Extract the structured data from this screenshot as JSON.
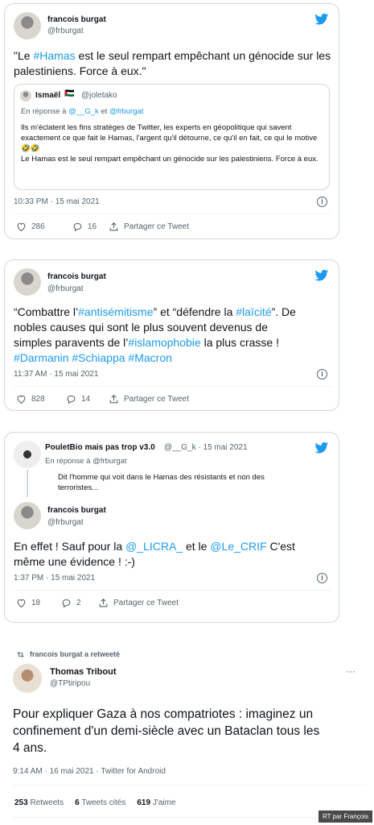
{
  "tweet1": {
    "name": "francois burgat",
    "handle": "@frburgat",
    "text_parts": [
      "\"Le ",
      "#Hamas",
      " est le seul rempart empêchant un génocide sur les palestiniens. Force à eux.\""
    ],
    "quote": {
      "name": "Ismaël",
      "flag": "🇵🇸",
      "handle": "@joletako",
      "reply_prefix": "En réponse à",
      "reply_users": [
        "@__G_k",
        "et",
        "@frburgat"
      ],
      "text": "Ils m'éclatent les fins stratèges de Twitter, les experts en géopolitique qui savent exactement ce que fait le Hamas, l'argent qu'il détourne, ce qu'il en fait, ce qui le motive🤣🤣\nLe Hamas est le seul rempart empêchant un génocide sur les palestiniens. Force à eux."
    },
    "time": "10:33 PM · 15 mai 2021",
    "likes": "286",
    "replies": "16",
    "share_label": "Partager ce Tweet"
  },
  "tweet2": {
    "name": "francois burgat",
    "handle": "@frburgat",
    "line1_parts": [
      "“Combattre l’",
      "#antisémitisme",
      "” et “défendre la ",
      "#laïcité",
      "”. De"
    ],
    "line2": "nobles causes qui  sont le plus souvent devenus de",
    "line3_parts": [
      "simples paravents de l’",
      "#islamophobie",
      " la plus crasse !"
    ],
    "line4": "#Darmanin #Schiappa #Macron",
    "time": "11:37 AM · 15 mai 2021",
    "likes": "828",
    "replies": "14",
    "share_label": "Partager ce Tweet"
  },
  "tweet3": {
    "parent_name": "PouletBio mais pas trop v3.0",
    "parent_handle_time": "@__G_k · 15 mai 2021",
    "parent_reply": "En réponse à @frburgat",
    "parent_text_1": "Dit l'homme qui voit dans le Hamas des résistants et non des",
    "parent_text_2": "terroristes...",
    "name": "francois burgat",
    "handle": "@frburgat",
    "text_parts": [
      "En effet ! Sauf pour la ",
      "@_LICRA_",
      "  et le ",
      "@Le_CRIF",
      "  C'est"
    ],
    "text_line2": "même une évidence ! :-)",
    "time": "1:37 PM · 15 mai 2021",
    "likes": "18",
    "replies": "2",
    "share_label": "Partager ce Tweet"
  },
  "tweet4": {
    "retweet_label": "francois burgat a retweeté",
    "name": "Thomas Tribout",
    "handle": "@TPtiripou",
    "more": "···",
    "text_1": "Pour expliquer Gaza à nos compatriotes : imaginez  un",
    "text_2": "confinement d'un demi-siècle avec un Bataclan tous les",
    "text_3": "4 ans.",
    "time": "9:14 AM · 16 mai 2021 · Twitter for Android",
    "retweets_count": "253",
    "retweets_label": "Retweets",
    "quotes_count": "6",
    "quotes_label": "Tweets cités",
    "likes_count": "619",
    "likes_label": "J'aime"
  },
  "badge": "RT par François",
  "colors": {
    "link": "#1d9bf0",
    "muted": "#536471",
    "border": "#cfd9de"
  }
}
